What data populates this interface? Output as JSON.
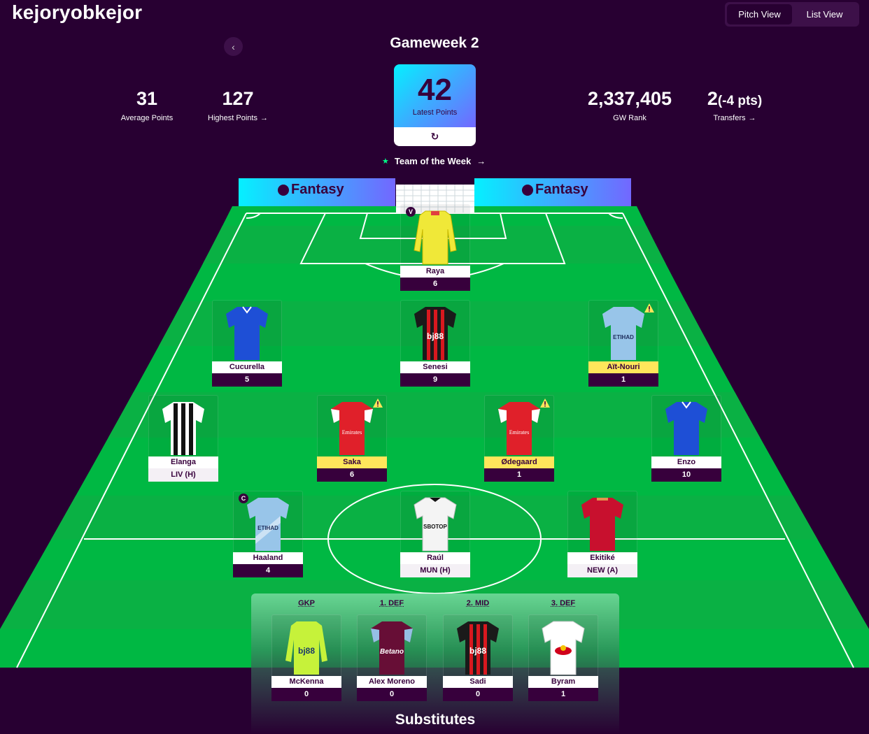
{
  "team_name": "kejoryobkejor",
  "view_toggle": {
    "pitch": "Pitch View",
    "list": "List View"
  },
  "gameweek": {
    "title": "Gameweek 2",
    "prev_icon": "‹"
  },
  "stats": {
    "average": {
      "value": "31",
      "label": "Average Points"
    },
    "highest": {
      "value": "127",
      "label": "Highest Points",
      "arrow": "→"
    },
    "latest": {
      "value": "42",
      "label": "Latest Points",
      "refresh": "↻"
    },
    "rank": {
      "value": "2,337,405",
      "label": "GW Rank"
    },
    "transfers": {
      "value": "2",
      "extra": "(-4 pts)",
      "label": "Transfers",
      "arrow": "→"
    }
  },
  "team_of_week": {
    "star": "★",
    "label": "Team of the Week",
    "arrow": "→"
  },
  "banner": {
    "left": "Fantasy",
    "right": "Fantasy"
  },
  "colors": {
    "bg": "#280032",
    "pitch": "#00b843",
    "purple": "#37003c",
    "warning": "#ffe65b"
  },
  "players": {
    "raya": {
      "name": "Raya",
      "pts": "6",
      "badge": "V"
    },
    "cucurella": {
      "name": "Cucurella",
      "pts": "5"
    },
    "senesi": {
      "name": "Senesi",
      "pts": "9"
    },
    "aitnouri": {
      "name": "Aït-Nouri",
      "pts": "1"
    },
    "elanga": {
      "name": "Elanga",
      "pts": "LIV (H)"
    },
    "saka": {
      "name": "Saka",
      "pts": "6"
    },
    "odegaard": {
      "name": "Ødegaard",
      "pts": "1"
    },
    "enzo": {
      "name": "Enzo",
      "pts": "10"
    },
    "haaland": {
      "name": "Haaland",
      "pts": "4",
      "badge": "C"
    },
    "raul": {
      "name": "Raúl",
      "pts": "MUN (H)"
    },
    "ekitike": {
      "name": "Ekitiké",
      "pts": "NEW (A)"
    }
  },
  "bench": {
    "positions": [
      "GKP",
      "1. DEF",
      "2. MID",
      "3. DEF"
    ],
    "mckenna": {
      "name": "McKenna",
      "pts": "0"
    },
    "moreno": {
      "name": "Alex Moreno",
      "pts": "0"
    },
    "sadi": {
      "name": "Sadi",
      "pts": "0"
    },
    "byram": {
      "name": "Byram",
      "pts": "1"
    },
    "title": "Substitutes"
  }
}
